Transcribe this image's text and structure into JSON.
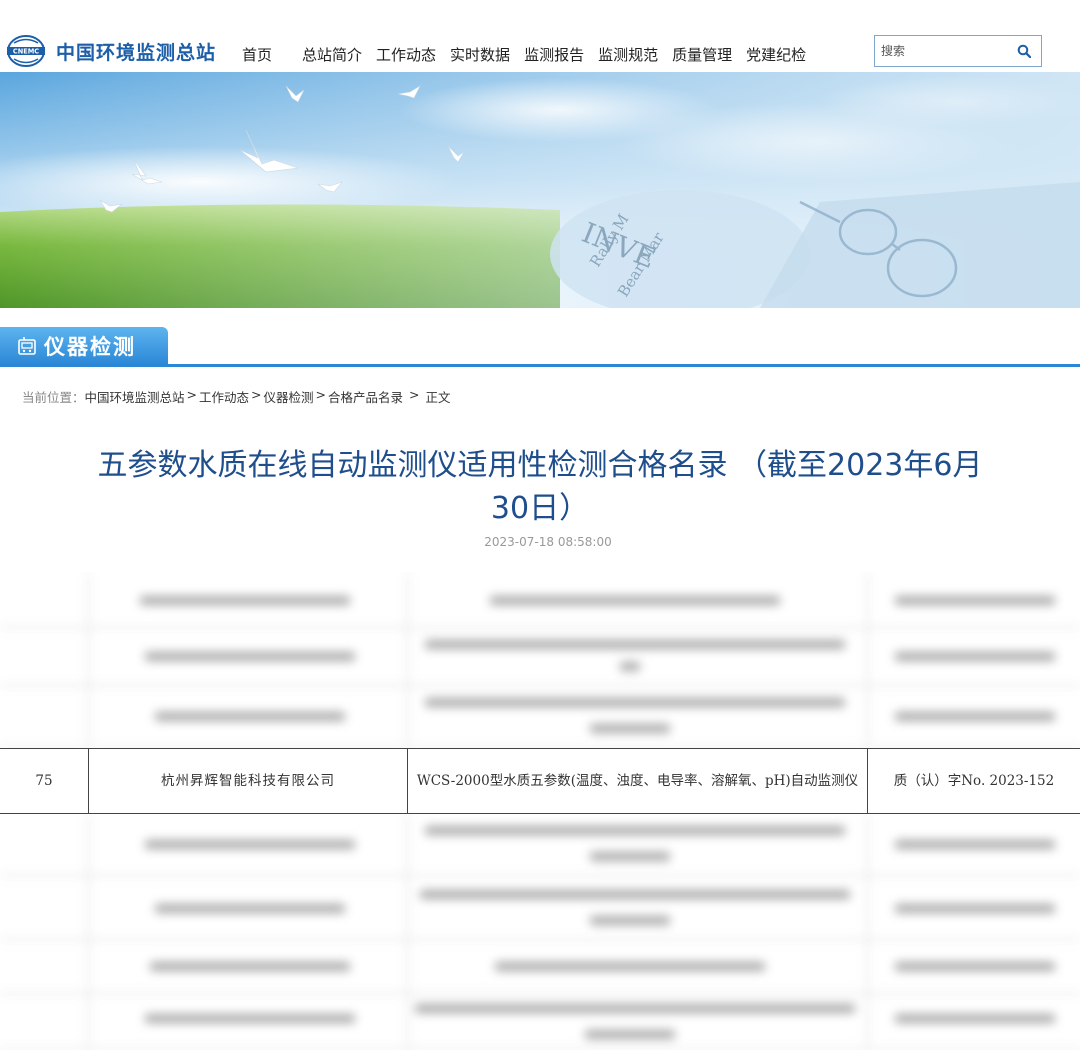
{
  "site": {
    "logo_badge": "CNEMC",
    "name": "中国环境监测总站"
  },
  "nav": {
    "items": [
      "首页",
      "总站简介",
      "工作动态",
      "实时数据",
      "监测报告",
      "监测规范",
      "质量管理",
      "党建纪检"
    ]
  },
  "search": {
    "placeholder": "搜索"
  },
  "banner": {
    "text_top": "INVE",
    "text_mid": "Rally M",
    "text_low": "Bear Mar"
  },
  "section": {
    "title": "仪器检测"
  },
  "breadcrumb": {
    "prefix": "当前位置：",
    "items": [
      "中国环境监测总站",
      "工作动态",
      "仪器检测",
      "合格产品名录"
    ],
    "current": "正文",
    "separator": ">"
  },
  "article": {
    "title": "五参数水质在线自动监测仪适用性检测合格名录 （截至2023年6月30日）",
    "date": "2023-07-18 08:58:00"
  },
  "table": {
    "highlighted_row": {
      "no": "75",
      "company": "杭州昇辉智能科技有限公司",
      "product": "WCS-2000型水质五参数(温度、浊度、电导率、溶解氧、pH)自动监测仪",
      "certificate": "质（认）字No. 2023-152"
    }
  },
  "colors": {
    "brand_blue": "#1d5ea8",
    "title_blue": "#1f4e8c",
    "section_blue": "#2b87d6"
  }
}
